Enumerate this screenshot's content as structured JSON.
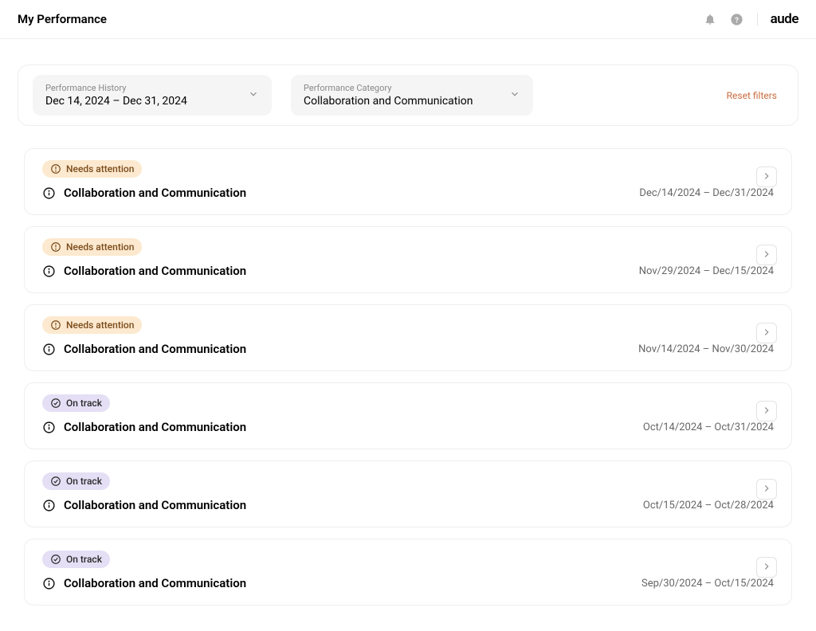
{
  "header": {
    "title": "My Performance",
    "logo": "aude"
  },
  "filters": {
    "history": {
      "label": "Performance History",
      "value": "Dec 14, 2024 – Dec 31, 2024"
    },
    "category": {
      "label": "Performance Category",
      "value": "Collaboration and Communication"
    },
    "reset_label": "Reset filters"
  },
  "status_labels": {
    "needs_attention": "Needs attention",
    "on_track": "On track"
  },
  "cards": [
    {
      "status": "needs_attention",
      "title": "Collaboration and Communication",
      "date_range": "Dec/14/2024 – Dec/31/2024"
    },
    {
      "status": "needs_attention",
      "title": "Collaboration and Communication",
      "date_range": "Nov/29/2024 – Dec/15/2024"
    },
    {
      "status": "needs_attention",
      "title": "Collaboration and Communication",
      "date_range": "Nov/14/2024 – Nov/30/2024"
    },
    {
      "status": "on_track",
      "title": "Collaboration and Communication",
      "date_range": "Oct/14/2024 – Oct/31/2024"
    },
    {
      "status": "on_track",
      "title": "Collaboration and Communication",
      "date_range": "Oct/15/2024 – Oct/28/2024"
    },
    {
      "status": "on_track",
      "title": "Collaboration and Communication",
      "date_range": "Sep/30/2024 – Oct/15/2024"
    }
  ]
}
